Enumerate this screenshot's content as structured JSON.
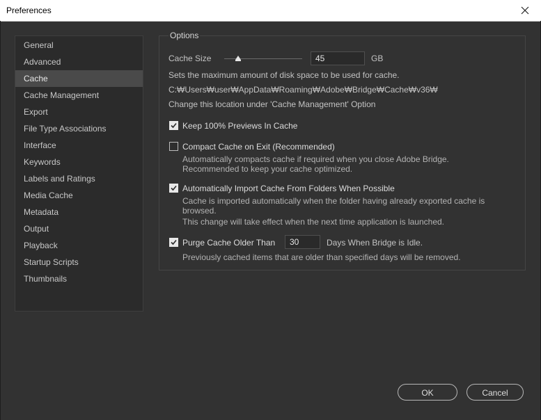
{
  "window": {
    "title": "Preferences"
  },
  "sidebar": {
    "items": [
      {
        "label": "General"
      },
      {
        "label": "Advanced"
      },
      {
        "label": "Cache",
        "selected": true
      },
      {
        "label": "Cache Management"
      },
      {
        "label": "Export"
      },
      {
        "label": "File Type Associations"
      },
      {
        "label": "Interface"
      },
      {
        "label": "Keywords"
      },
      {
        "label": "Labels and Ratings"
      },
      {
        "label": "Media Cache"
      },
      {
        "label": "Metadata"
      },
      {
        "label": "Output"
      },
      {
        "label": "Playback"
      },
      {
        "label": "Startup Scripts"
      },
      {
        "label": "Thumbnails"
      }
    ]
  },
  "options": {
    "legend": "Options",
    "cache_size": {
      "label": "Cache Size",
      "value": "45",
      "unit": "GB",
      "slider_fraction": 0.18
    },
    "cache_size_desc": "Sets the maximum amount of disk space to be used for cache.",
    "cache_path": "C:₩Users₩user₩AppData₩Roaming₩Adobe₩Bridge₩Cache₩v36₩",
    "location_hint": "Change this location under 'Cache Management' Option",
    "keep_previews": {
      "label": "Keep 100% Previews In Cache",
      "checked": true
    },
    "compact_on_exit": {
      "label": "Compact Cache on Exit (Recommended)",
      "checked": false,
      "desc_line1": "Automatically compacts cache if required when you close Adobe Bridge.",
      "desc_line2": "Recommended to keep your cache optimized."
    },
    "auto_import": {
      "label": "Automatically Import Cache From Folders When Possible",
      "checked": true,
      "desc_line1": "Cache is imported automatically when the folder having already exported cache is",
      "desc_line2": "browsed.",
      "desc_line3": "This change will take effect when the next time application is launched."
    },
    "purge": {
      "label": "Purge Cache Older Than",
      "checked": true,
      "value": "30",
      "suffix": "Days When Bridge is Idle.",
      "desc": "Previously cached items that are older than specified days will be removed."
    }
  },
  "buttons": {
    "ok": "OK",
    "cancel": "Cancel"
  }
}
